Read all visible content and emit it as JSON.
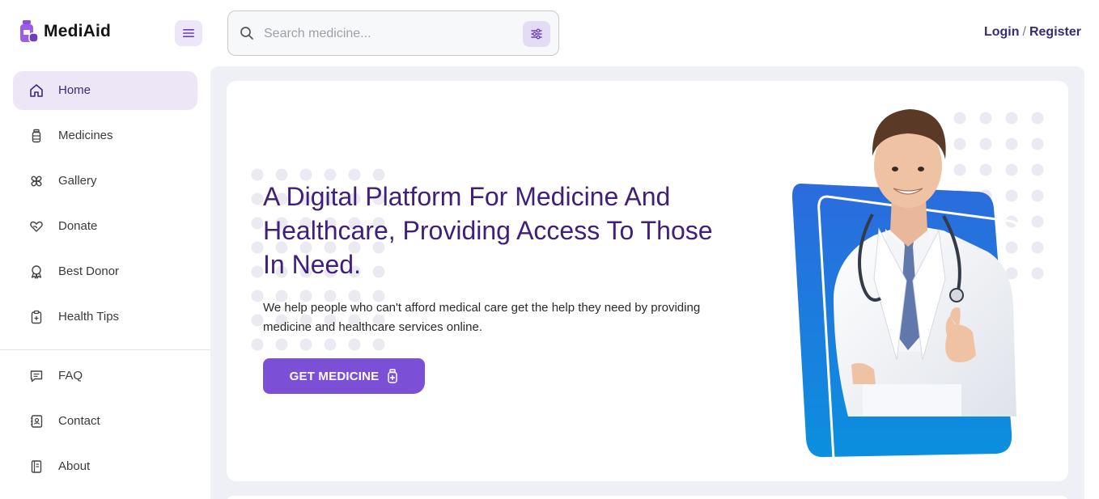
{
  "brand": {
    "name": "MediAid"
  },
  "search": {
    "placeholder": "Search medicine..."
  },
  "auth": {
    "login": "Login",
    "separator": "/",
    "register": "Register"
  },
  "sidebar": {
    "items": [
      {
        "label": "Home",
        "icon": "home-icon",
        "active": true
      },
      {
        "label": "Medicines",
        "icon": "medicine-bottle-icon"
      },
      {
        "label": "Gallery",
        "icon": "gallery-icon"
      },
      {
        "label": "Donate",
        "icon": "heart-hand-icon"
      },
      {
        "label": "Best Donor",
        "icon": "award-icon"
      },
      {
        "label": "Health Tips",
        "icon": "clipboard-icon"
      }
    ],
    "secondary": [
      {
        "label": "FAQ",
        "icon": "chat-icon"
      },
      {
        "label": "Contact",
        "icon": "contact-book-icon"
      },
      {
        "label": "About",
        "icon": "book-icon"
      }
    ]
  },
  "hero": {
    "title": "A Digital Platform For Medicine And Healthcare, Providing Access To Those In Need.",
    "description": "We help people who can't afford medical care get the help they need by providing medicine and healthcare services online.",
    "cta_label": "GET MEDICINE"
  },
  "colors": {
    "accent": "#7b4fd6",
    "heading": "#3f1f7c",
    "active_bg": "#ede6f7",
    "main_bg": "#eef0f5"
  }
}
